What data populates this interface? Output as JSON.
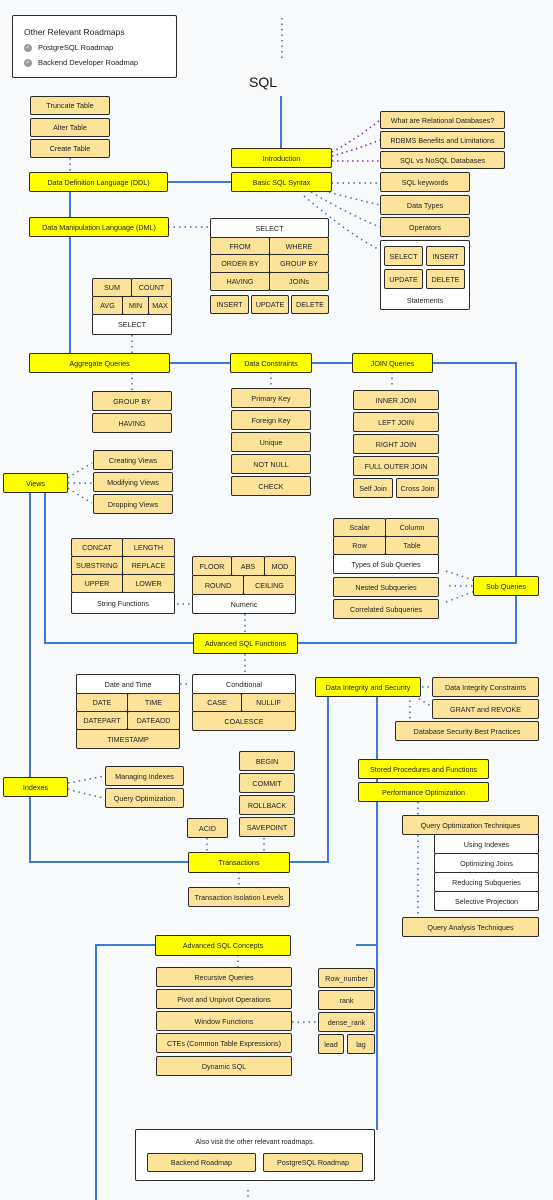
{
  "colors": {
    "main_topic": "#ffff00",
    "subtopic": "#fde39a",
    "group_bg": "#ffffff",
    "border": "#2b2b2b",
    "solid_line": "#3b7bd4",
    "dotted_blue": "#3f6fb3",
    "dotted_purple": "#8e2bb5",
    "background": "#f8f9fb"
  },
  "legend": {
    "title": "Other Relevant Roadmaps",
    "items": [
      {
        "label": "PostgreSQL Roadmap",
        "icon": "check-circle-icon"
      },
      {
        "label": "Backend Developer Roadmap",
        "icon": "check-circle-icon"
      }
    ]
  },
  "title": "SQL",
  "main": {
    "introduction": "Introduction",
    "basic_syntax": "Basic SQL Syntax",
    "ddl": "Data Definition Language (DDL)",
    "dml": "Data Manipulation Language (DML)",
    "aggregate": "Aggregate Queries",
    "constraints": "Data Constraints",
    "joins": "JOIN Queries",
    "views": "Views",
    "subqueries": "Sub Queries",
    "advanced_functions": "Advanced SQL Functions",
    "integrity_security": "Data Integrity and Security",
    "indexes": "Indexes",
    "stored_procedures": "Stored Procedures and Functions",
    "performance": "Performance Optimization",
    "transactions": "Transactions",
    "advanced_concepts": "Advanced SQL Concepts"
  },
  "intro_topics": [
    "What are Relational Databases?",
    "RDBMS Benefits and Limitations",
    "SQL vs NoSQL Databases"
  ],
  "syntax_topics": [
    "SQL keywords",
    "Data Types",
    "Operators"
  ],
  "statements": {
    "items": [
      "SELECT",
      "INSERT",
      "UPDATE",
      "DELETE"
    ],
    "label": "Statements"
  },
  "ddl_topics": [
    "Truncate Table",
    "Alter Table",
    "Create Table"
  ],
  "dml_select": {
    "label": "SELECT",
    "clauses": [
      "FROM",
      "WHERE",
      "ORDER BY",
      "GROUP BY",
      "HAVING",
      "JOINs"
    ],
    "others": [
      "INSERT",
      "UPDATE",
      "DELETE"
    ]
  },
  "aggregate_select": {
    "row1": [
      "SUM",
      "COUNT"
    ],
    "row2": [
      "AVG",
      "MIN",
      "MAX"
    ],
    "label": "SELECT"
  },
  "aggregate_topics": [
    "GROUP BY",
    "HAVING"
  ],
  "constraint_topics": [
    "Primary Key",
    "Foreign Key",
    "Unique",
    "NOT NULL",
    "CHECK"
  ],
  "join_topics": [
    "INNER JOIN",
    "LEFT JOIN",
    "RIGHT JOIN",
    "FULL OUTER JOIN"
  ],
  "join_small": [
    "Self Join",
    "Cross Join"
  ],
  "view_topics": [
    "Creating Views",
    "Modifying Views",
    "Dropping Views"
  ],
  "string_functions": {
    "items": [
      "CONCAT",
      "LENGTH",
      "SUBSTRING",
      "REPLACE",
      "UPPER",
      "LOWER"
    ],
    "label": "String Functions"
  },
  "numeric_functions": {
    "row1": [
      "FLOOR",
      "ABS",
      "MOD"
    ],
    "row2": [
      "ROUND",
      "CEILING"
    ],
    "label": "Numeric"
  },
  "subquery_types": {
    "items": [
      "Scalar",
      "Column",
      "Row",
      "Table"
    ],
    "label": "Types of Sub Queries"
  },
  "subquery_topics": [
    "Nested Subqueries",
    "Correlated Subqueries"
  ],
  "date_time": {
    "label": "Date and Time",
    "items": [
      "DATE",
      "TIME",
      "DATEPART",
      "DATEADD"
    ],
    "wide": "TIMESTAMP"
  },
  "conditional": {
    "label": "Conditional",
    "items": [
      "CASE",
      "NULLIF"
    ],
    "wide": "COALESCE"
  },
  "integrity_topics": [
    "Data Integrity Constraints",
    "GRANT and REVOKE",
    "Database Security Best Practices"
  ],
  "index_topics": [
    "Managing Indexes",
    "Query Optimization"
  ],
  "transaction_cmds": [
    "BEGIN",
    "COMMIT",
    "ROLLBACK",
    "SAVEPOINT"
  ],
  "acid": "ACID",
  "isolation": "Transaction Isolation Levels",
  "query_opt": {
    "label": "Query Optimization Techniques",
    "items": [
      "Using Indexes",
      "Optimizing Joins",
      "Reducing Subqueries",
      "Selective Projection"
    ]
  },
  "query_analysis": "Query Analysis Techniques",
  "concept_topics": [
    "Recursive Queries",
    "Pivot and Unpivot Operations",
    "Window Functions",
    "CTEs (Common Table Expressions)",
    "Dynamic SQL"
  ],
  "window_functions": [
    "Row_number",
    "rank",
    "dense_rank",
    "lead",
    "lag"
  ],
  "footer": {
    "message": "Also visit the other relevant roadmaps.",
    "links": [
      "Backend Roadmap",
      "PostgreSQL Roadmap"
    ]
  }
}
